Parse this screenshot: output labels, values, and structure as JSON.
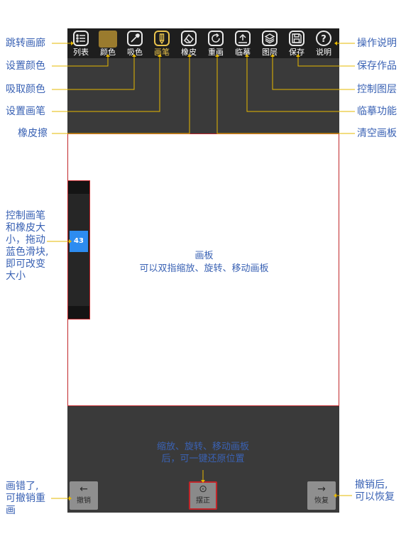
{
  "toolbar": {
    "items": [
      {
        "label": "列表",
        "icon": "list-icon"
      },
      {
        "label": "颜色",
        "icon": "color-swatch"
      },
      {
        "label": "吸色",
        "icon": "eyedropper-icon"
      },
      {
        "label": "画笔",
        "icon": "pen-icon"
      },
      {
        "label": "橡皮",
        "icon": "eraser-icon"
      },
      {
        "label": "重画",
        "icon": "redraw-icon"
      },
      {
        "label": "临摹",
        "icon": "upload-icon"
      },
      {
        "label": "图层",
        "icon": "layers-icon"
      },
      {
        "label": "保存",
        "icon": "save-icon"
      },
      {
        "label": "说明",
        "icon": "help-icon"
      }
    ],
    "active_index": 3,
    "swatch_color": "#9a7b2e",
    "active_color": "#e9c34d"
  },
  "canvas": {
    "line1": "画板",
    "line2": "可以双指缩放、旋转、移动画板"
  },
  "slider": {
    "value": "43",
    "level": 0.43,
    "color": "#2d8cf0"
  },
  "bottom": {
    "hint_line1": "缩放、旋转、移动画板",
    "hint_line2": "后，可一键还原位置",
    "undo_label": "撤销",
    "reset_label": "摆正",
    "redo_label": "恢复"
  },
  "annotations": {
    "gallery": "跳转画廊",
    "set_color": "设置颜色",
    "pick_color": "吸取颜色",
    "set_pen": "设置画笔",
    "eraser": "橡皮擦",
    "slider_line1": "控制画笔",
    "slider_line2": "和橡皮大",
    "slider_line3": "小，拖动",
    "slider_line4": "蓝色滑块,",
    "slider_line5": "即可改变",
    "slider_line6": "大小",
    "undo_line1": "画错了,",
    "undo_line2": "可撤销重",
    "undo_line3": "画",
    "help": "操作说明",
    "save": "保存作品",
    "layers": "控制图层",
    "trace": "临摹功能",
    "clear": "清空画板",
    "redo_line1": "撤销后,",
    "redo_line2": "可以恢复"
  },
  "colors": {
    "annotation_text": "#3a62b4",
    "leader_line": "#e6b800",
    "highlight_border": "#c0262a"
  }
}
